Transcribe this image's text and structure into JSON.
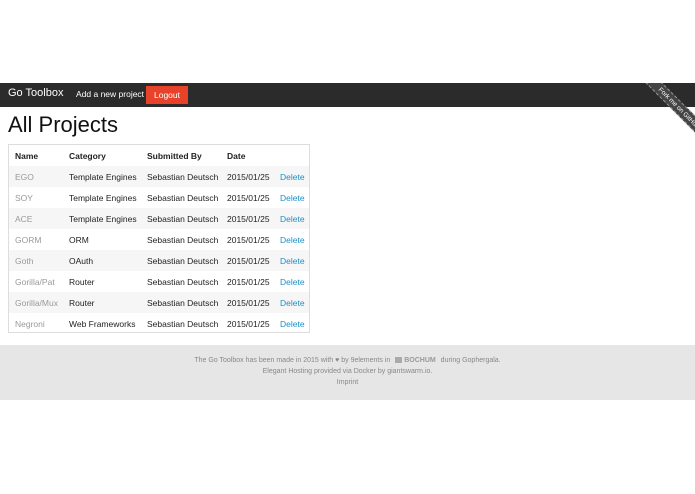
{
  "navbar": {
    "brand": "Go Toolbox",
    "add_project": "Add a new project",
    "logout": "Logout",
    "ribbon": "Fork me on GitHub"
  },
  "page_title": "All Projects",
  "table": {
    "headers": [
      "Name",
      "Category",
      "Submitted By",
      "Date"
    ],
    "delete_label": "Delete",
    "rows": [
      {
        "name": "EGO",
        "category": "Template Engines",
        "submitted_by": "Sebastian Deutsch",
        "date": "2015/01/25"
      },
      {
        "name": "SOY",
        "category": "Template Engines",
        "submitted_by": "Sebastian Deutsch",
        "date": "2015/01/25"
      },
      {
        "name": "ACE",
        "category": "Template Engines",
        "submitted_by": "Sebastian Deutsch",
        "date": "2015/01/25"
      },
      {
        "name": "GORM",
        "category": "ORM",
        "submitted_by": "Sebastian Deutsch",
        "date": "2015/01/25"
      },
      {
        "name": "Goth",
        "category": "OAuth",
        "submitted_by": "Sebastian Deutsch",
        "date": "2015/01/25"
      },
      {
        "name": "Gorilla/Pat",
        "category": "Router",
        "submitted_by": "Sebastian Deutsch",
        "date": "2015/01/25"
      },
      {
        "name": "Gorilla/Mux",
        "category": "Router",
        "submitted_by": "Sebastian Deutsch",
        "date": "2015/01/25"
      },
      {
        "name": "Negroni",
        "category": "Web Frameworks",
        "submitted_by": "Sebastian Deutsch",
        "date": "2015/01/25"
      }
    ]
  },
  "footer": {
    "made_prefix": "The Go Toolbox has been made in 2015 with ♥ by",
    "made_by": "9elements",
    "in_word": "in",
    "city_logo": "BOCHUM",
    "during": "during",
    "event": "Gophergala.",
    "hosting_prefix": "Elegant Hosting provided via",
    "docker": "Docker",
    "by_word": "by",
    "host": "giantswarm.io.",
    "imprint": "Imprint"
  },
  "colors": {
    "navbar": "#2b2b2b",
    "logout": "#e8422b",
    "link": "#1a8fc9",
    "footer": "#e6e6e6"
  }
}
